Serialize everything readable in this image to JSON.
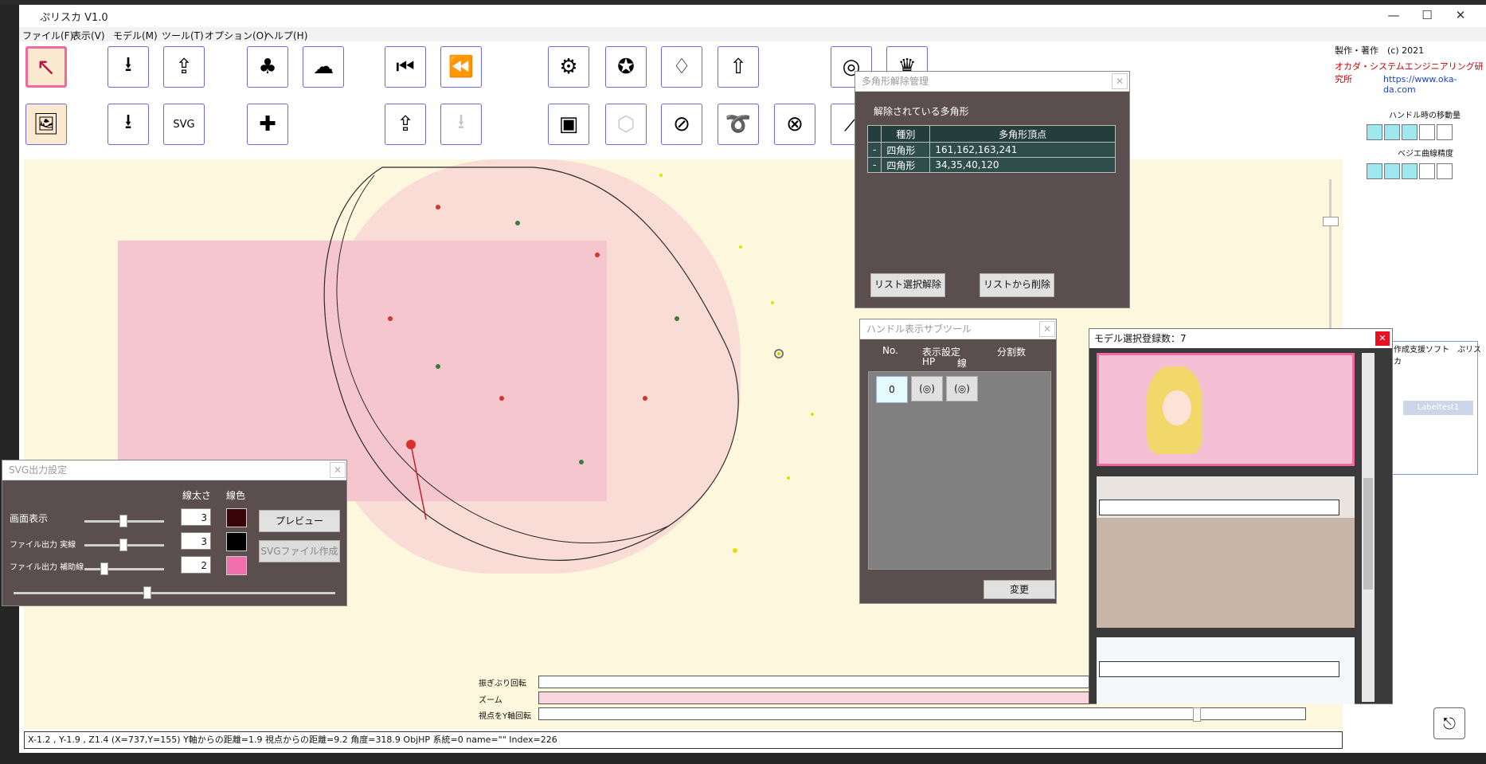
{
  "window": {
    "title": "ぷリスカ V1.0",
    "min": "—",
    "max": "☐",
    "close": "✕"
  },
  "menu": [
    "ファイル(F)",
    "表示(V)",
    "モデル(M)",
    "ツール(T)",
    "オプション(O)",
    "ヘルプ(H)"
  ],
  "toolbar_icons": [
    "select-arrow-icon",
    "import-icon",
    "export-upload-icon",
    "shadow-figure-icon",
    "image-figure-icon",
    "camera-cut-rewind-icon",
    "camera-rewind-icon",
    "settings-gear-icon",
    "badge-plus-icon",
    "dress-icon",
    "upload-star-icon",
    "ring-stack-icon",
    "crown-icon",
    "image-icon",
    "import-plus-icon",
    "export-svg-icon",
    "figure-plus-icon",
    "camera-upload-icon",
    "camera-import-icon",
    "image-frame-icon",
    "sphere-mesh-icon",
    "ellipse-orbit-icon",
    "ring-loop-icon",
    "orbit-lasso-icon",
    "diagonal-line-icon"
  ],
  "credits": {
    "line1": "製作・著作　(c) 2021",
    "line2": "オカダ・システムエンジニアリング研究所",
    "url": "https://www.oka-da.com"
  },
  "right_panel": {
    "handle_move_label": "ハンドル時の移動量",
    "bezier_label": "ベジエ曲線精度",
    "side_text": "作成支援ソフト　ぷリスカ",
    "labeltest": "Labeltest1"
  },
  "polygon_dialog": {
    "title": "多角形解除管理",
    "heading": "解除されている多角形",
    "columns": [
      "種別",
      "多角形頂点"
    ],
    "rows": [
      {
        "mark": "-",
        "type": "四角形",
        "vertices": "161,162,163,241"
      },
      {
        "mark": "-",
        "type": "四角形",
        "vertices": "34,35,40,120"
      }
    ],
    "btn_clear": "リスト選択解除",
    "btn_delete": "リストから削除",
    "close": "✕"
  },
  "handle_dialog": {
    "title": "ハンドル表示サブツール",
    "col_no": "No.",
    "col_display": "表示設定",
    "col_hp": "HP",
    "col_line": "線",
    "col_split": "分割数",
    "row_no": "0",
    "row_hp": "(◎)",
    "row_line": "(◎)",
    "btn_change": "変更",
    "close": "✕"
  },
  "model_dialog": {
    "title": "モデル選択登録数：7",
    "close": "✕"
  },
  "svg_dialog": {
    "title": "SVG出力設定",
    "col_width": "線太さ",
    "col_color": "線色",
    "rows": [
      {
        "label": "画面表示",
        "width": "3",
        "color": "#3a0508"
      },
      {
        "label": "ファイル出力 実線",
        "width": "3",
        "color": "#000000"
      },
      {
        "label": "ファイル出力 補助線",
        "width": "2",
        "color": "#f26fae"
      }
    ],
    "btn_preview": "プレビュー",
    "btn_create": "SVGファイル作成",
    "close": "✕"
  },
  "bottom_sliders": {
    "rotate_label": "振ぎぶり回転",
    "zoom_label": "ズーム",
    "yaxis_label": "視点をY軸回転"
  },
  "status": "X-1.2 , Y-1.9 , Z1.4  (X=737,Y=155)  Y軸からの距離=1.9  視点からの距離=9.2  角度=318.9 ObjHP 系統=0 name=\"\"  Index=226",
  "colors": {
    "accent_pink": "#f06aa0",
    "dialog_bg": "#5b4e4e",
    "table_bg": "#2f4d4a",
    "canvas_bg": "#fdf7dd",
    "cyan_square": "#9fe8f0"
  }
}
